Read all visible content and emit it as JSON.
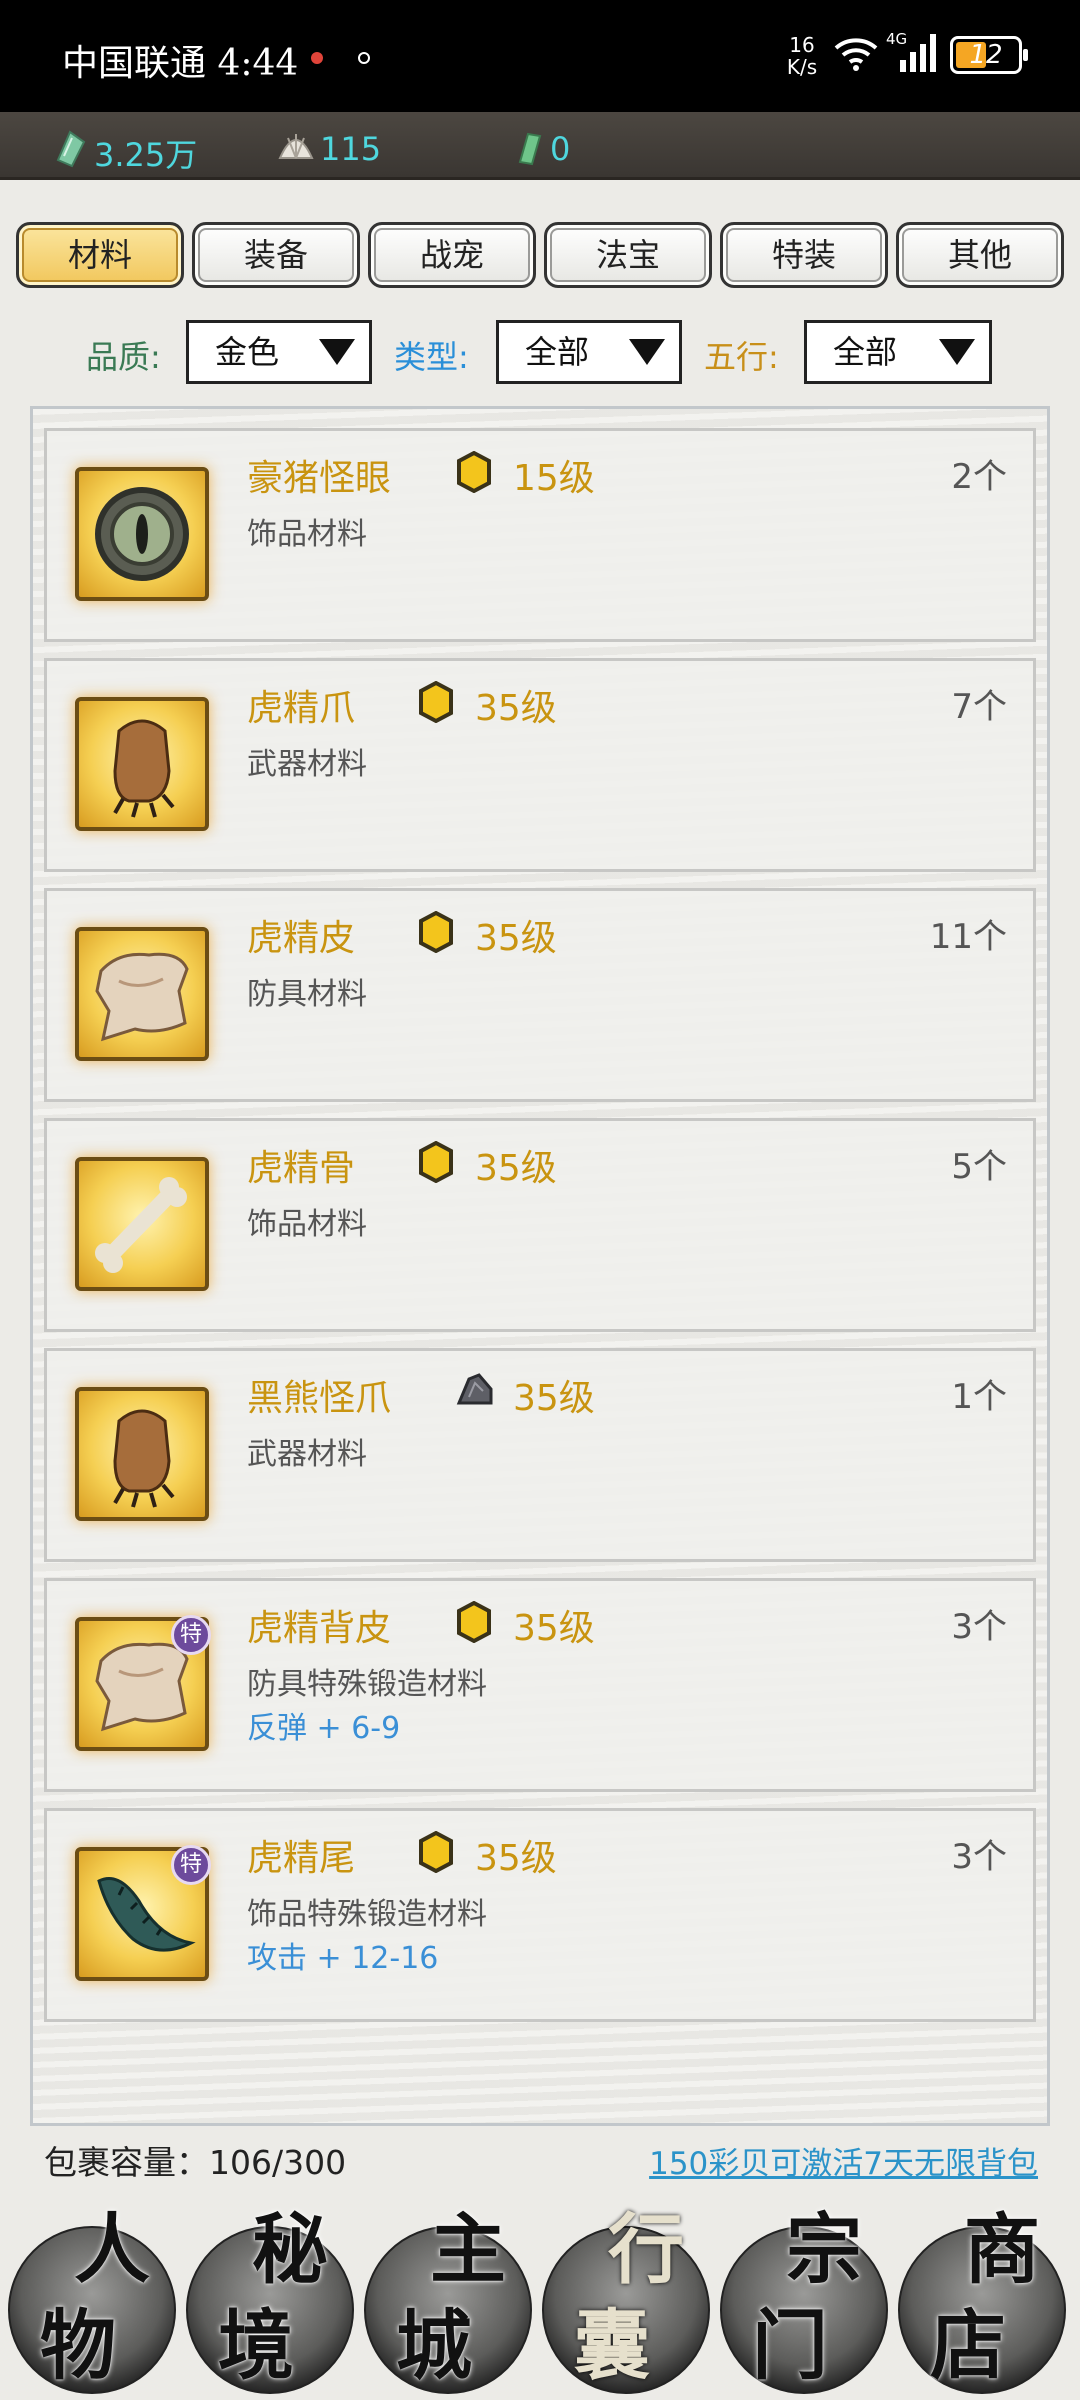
{
  "status_bar": {
    "carrier_time": "中国联通 4:44",
    "net_speed_value": "16",
    "net_speed_unit": "K/s",
    "network": "4G",
    "battery": "12"
  },
  "currencies": [
    {
      "icon": "jade-icon",
      "value": "3.25万"
    },
    {
      "icon": "shell-icon",
      "value": "115"
    },
    {
      "icon": "token-icon",
      "value": "0"
    }
  ],
  "tabs": [
    {
      "label": "材料",
      "active": true
    },
    {
      "label": "装备",
      "active": false
    },
    {
      "label": "战宠",
      "active": false
    },
    {
      "label": "法宝",
      "active": false
    },
    {
      "label": "特装",
      "active": false
    },
    {
      "label": "其他",
      "active": false
    }
  ],
  "filters": {
    "quality_label": "品质:",
    "quality_value": "金色",
    "type_label": "类型:",
    "type_value": "全部",
    "element_label": "五行:",
    "element_value": "全部",
    "colors": {
      "quality": "#3a7a54",
      "type": "#2a8fd8",
      "element": "#c88f19"
    }
  },
  "items": [
    {
      "name": "豪猪怪眼",
      "grade": "gold",
      "level": "15级",
      "qty": "2个",
      "type": "饰品材料",
      "bonus": "",
      "special": false,
      "icon": "eye-icon"
    },
    {
      "name": "虎精爪",
      "grade": "gold",
      "level": "35级",
      "qty": "7个",
      "type": "武器材料",
      "bonus": "",
      "special": false,
      "icon": "claw-icon"
    },
    {
      "name": "虎精皮",
      "grade": "gold",
      "level": "35级",
      "qty": "11个",
      "type": "防具材料",
      "bonus": "",
      "special": false,
      "icon": "pelt-icon"
    },
    {
      "name": "虎精骨",
      "grade": "gold",
      "level": "35级",
      "qty": "5个",
      "type": "饰品材料",
      "bonus": "",
      "special": false,
      "icon": "bone-icon"
    },
    {
      "name": "黑熊怪爪",
      "grade": "iron",
      "level": "35级",
      "qty": "1个",
      "type": "武器材料",
      "bonus": "",
      "special": false,
      "icon": "claw-icon"
    },
    {
      "name": "虎精背皮",
      "grade": "gold",
      "level": "35级",
      "qty": "3个",
      "type": "防具特殊锻造材料",
      "bonus": "反弹 + 6-9",
      "special": true,
      "badge": "特",
      "icon": "pelt-icon"
    },
    {
      "name": "虎精尾",
      "grade": "gold",
      "level": "35级",
      "qty": "3个",
      "type": "饰品特殊锻造材料",
      "bonus": "攻击 + 12-16",
      "special": true,
      "badge": "特",
      "icon": "tail-icon"
    }
  ],
  "footer": {
    "capacity": "包裹容量：106/300",
    "promo": "150彩贝可激活7天无限背包"
  },
  "bottom_nav": [
    {
      "c1": "人",
      "c2": "物",
      "active": false
    },
    {
      "c1": "秘",
      "c2": "境",
      "active": false
    },
    {
      "c1": "主",
      "c2": "城",
      "active": false
    },
    {
      "c1": "行",
      "c2": "囊",
      "active": true
    },
    {
      "c1": "宗",
      "c2": "门",
      "active": false
    },
    {
      "c1": "商",
      "c2": "店",
      "active": false
    }
  ]
}
